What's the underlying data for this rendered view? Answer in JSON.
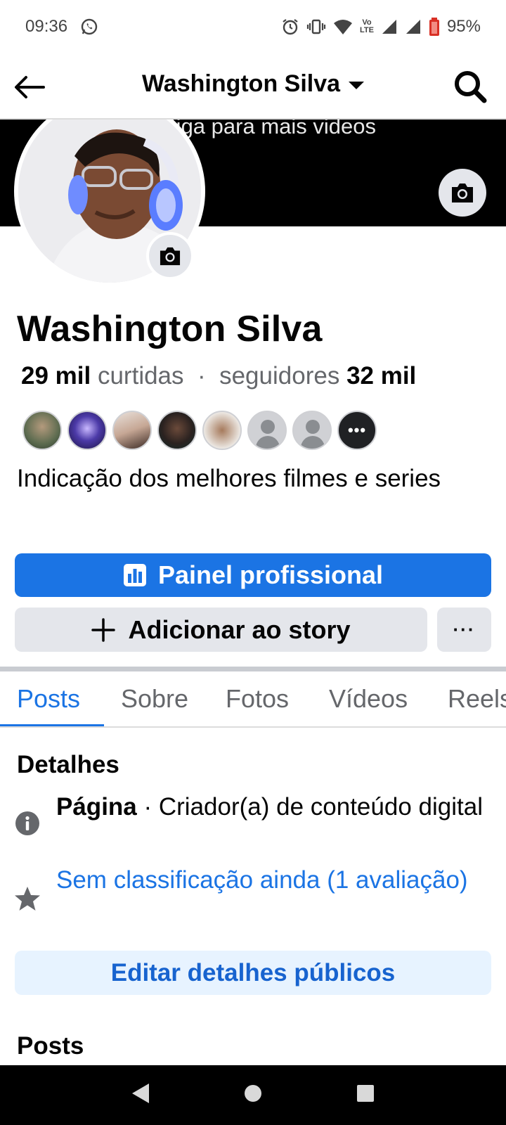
{
  "status_bar": {
    "time": "09:36",
    "battery": "95%",
    "lte_top": "Vo",
    "lte_bottom": "LTE"
  },
  "header": {
    "title": "Washington Silva"
  },
  "cover": {
    "text": "Siga para mais videos"
  },
  "profile": {
    "name": "Washington Silva",
    "likes_count": "29 mil",
    "likes_label": "curtidas",
    "separator": "·",
    "followers_label": "seguidores",
    "followers_count": "32 mil",
    "bio": "Indicação dos melhores filmes e series",
    "more_friends": "•••"
  },
  "actions": {
    "dashboard_label": "Painel profissional",
    "story_label": "Adicionar ao story",
    "more_label": "···"
  },
  "tabs": [
    {
      "label": "Posts"
    },
    {
      "label": "Sobre"
    },
    {
      "label": "Fotos"
    },
    {
      "label": "Vídeos"
    },
    {
      "label": "Reels"
    }
  ],
  "details": {
    "title": "Detalhes",
    "page_label": "Página",
    "page_category": " · Criador(a) de conteúdo digital",
    "rating_link": "Sem classificação ainda (1 avaliação)",
    "edit_button": "Editar detalhes públicos"
  },
  "posts_section": {
    "title": "Posts"
  },
  "colors": {
    "accent": "#1b74e4",
    "button_gray": "#e4e6eb",
    "edit_bg": "#e7f3ff"
  }
}
